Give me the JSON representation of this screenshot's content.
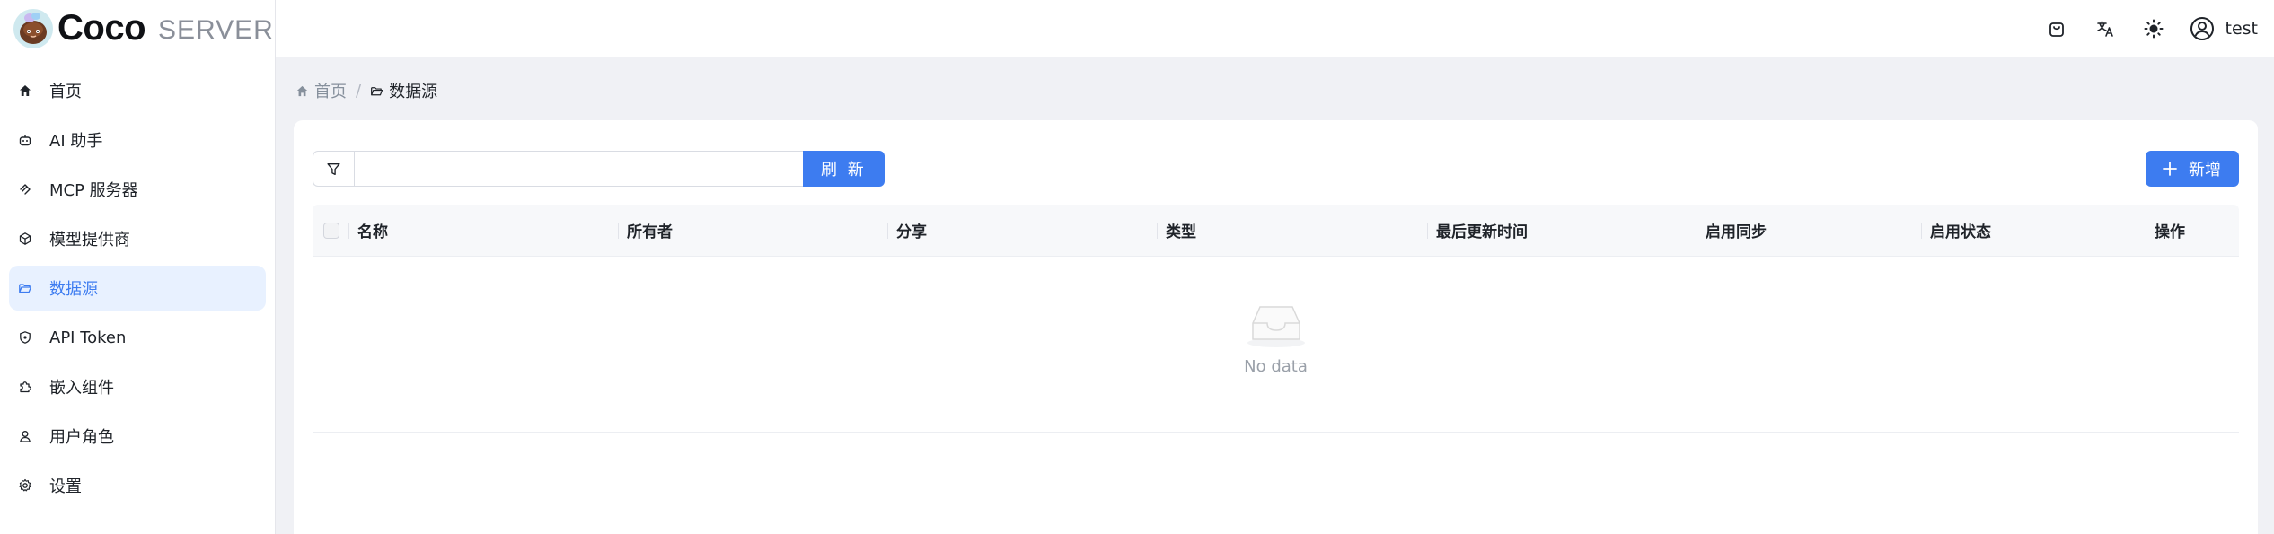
{
  "app": {
    "name": "Coco",
    "subtitle": "SERVER"
  },
  "sidebar": {
    "items": [
      {
        "label": "首页",
        "icon": "home-icon"
      },
      {
        "label": "AI 助手",
        "icon": "robot-icon"
      },
      {
        "label": "MCP 服务器",
        "icon": "mcp-icon"
      },
      {
        "label": "模型提供商",
        "icon": "cube-icon"
      },
      {
        "label": "数据源",
        "icon": "folder-open-icon",
        "active": true
      },
      {
        "label": "API Token",
        "icon": "shield-icon"
      },
      {
        "label": "嵌入组件",
        "icon": "puzzle-icon"
      },
      {
        "label": "用户角色",
        "icon": "user-icon"
      },
      {
        "label": "设置",
        "icon": "gear-icon"
      }
    ]
  },
  "header": {
    "icons": [
      "bag-icon",
      "translate-icon",
      "sun-icon"
    ],
    "username": "test"
  },
  "breadcrumb": {
    "home": "首页",
    "separator": "/",
    "current": "数据源"
  },
  "toolbar": {
    "search_value": "",
    "search_placeholder": "",
    "refresh_label": "刷 新",
    "add_label": "新增"
  },
  "table": {
    "columns": [
      "名称",
      "所有者",
      "分享",
      "类型",
      "最后更新时间",
      "启用同步",
      "启用状态",
      "操作"
    ],
    "rows": [],
    "empty_text": "No data"
  },
  "colors": {
    "accent": "#3d7cf0",
    "active_bg": "#e8f1ff",
    "main_bg": "#f0f1f5"
  }
}
